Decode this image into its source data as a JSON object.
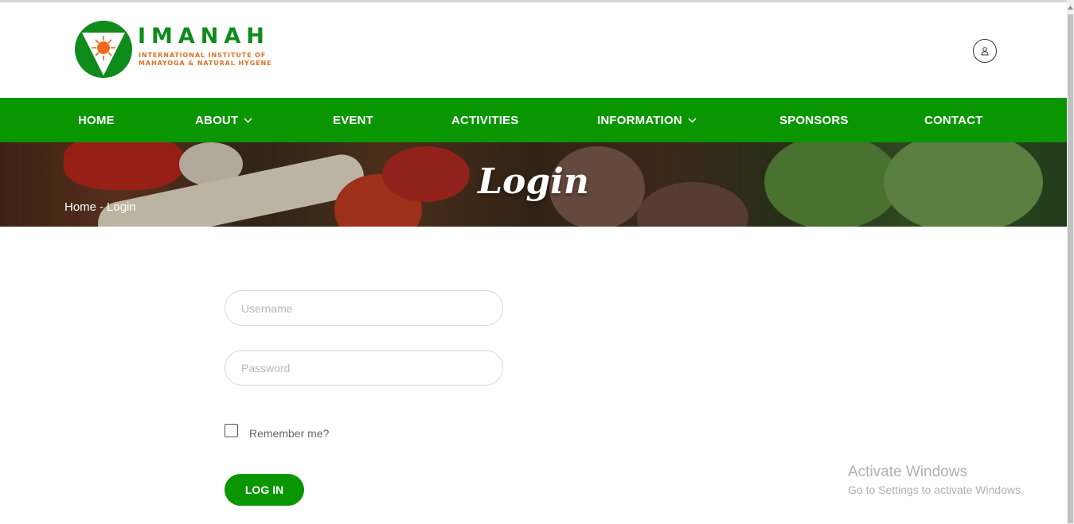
{
  "brand": {
    "name": "IMANAH",
    "tagline_line1": "INTERNATIONAL INSTITUTE OF",
    "tagline_line2": "MAHAYOGA & NATURAL HYGENE"
  },
  "header": {
    "account_icon": "user-icon"
  },
  "nav": {
    "items": [
      {
        "label": "HOME",
        "has_dropdown": false
      },
      {
        "label": "ABOUT",
        "has_dropdown": true
      },
      {
        "label": "EVENT",
        "has_dropdown": false
      },
      {
        "label": "ACTIVITIES",
        "has_dropdown": false
      },
      {
        "label": "INFORMATION",
        "has_dropdown": true
      },
      {
        "label": "SPONSORS",
        "has_dropdown": false
      },
      {
        "label": "CONTACT",
        "has_dropdown": false
      }
    ]
  },
  "banner": {
    "title": "Login",
    "breadcrumb": {
      "home": "Home",
      "separator": "-",
      "current": "Login"
    }
  },
  "form": {
    "username_placeholder": "Username",
    "username_value": "",
    "password_placeholder": "Password",
    "password_value": "",
    "remember_label": "Remember me?",
    "remember_checked": false,
    "submit_label": "LOG IN"
  },
  "watermark": {
    "title": "Activate Windows",
    "subtitle": "Go to Settings to activate Windows."
  },
  "colors": {
    "brand_green": "#0a9600",
    "logo_orange": "#e07020",
    "white": "#ffffff"
  }
}
